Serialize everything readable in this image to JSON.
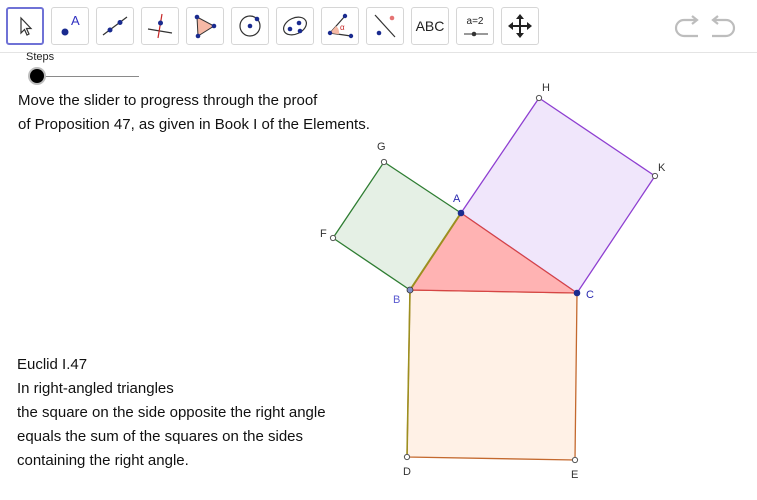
{
  "toolbar": {
    "tools": [
      {
        "name": "move-tool",
        "icon": "arrow-cursor-icon"
      },
      {
        "name": "point-tool",
        "icon": "point-icon",
        "glyph": "A"
      },
      {
        "name": "line-tool",
        "icon": "line-through-points-icon"
      },
      {
        "name": "perpendicular-tool",
        "icon": "perpendicular-line-icon"
      },
      {
        "name": "polygon-tool",
        "icon": "polygon-icon"
      },
      {
        "name": "circle-tool",
        "icon": "circle-center-point-icon"
      },
      {
        "name": "conic-tool",
        "icon": "ellipse-icon"
      },
      {
        "name": "angle-tool",
        "icon": "angle-icon"
      },
      {
        "name": "reflect-tool",
        "icon": "reflect-about-line-icon"
      },
      {
        "name": "text-tool",
        "icon": "text-icon",
        "label": "ABC"
      },
      {
        "name": "slider-tool",
        "icon": "slider-icon",
        "label": "a=2"
      },
      {
        "name": "move-view-tool",
        "icon": "move-graphics-view-icon"
      }
    ],
    "undo_icon": "undo-icon",
    "redo_icon": "redo-icon"
  },
  "slider": {
    "label": "Steps",
    "value": 0
  },
  "intro": {
    "line1": "Move the slider to progress through the proof",
    "line2": "of Proposition 47, as given in Book I of the Elements."
  },
  "statement": {
    "title": "Euclid I.47",
    "lines": [
      "In right-angled triangles",
      "the square on the side opposite the right angle",
      "equals the sum of the squares on the sides",
      "containing the right angle."
    ]
  },
  "points": {
    "A": "A",
    "B": "B",
    "C": "C",
    "D": "D",
    "E": "E",
    "F": "F",
    "G": "G",
    "H": "H",
    "K": "K"
  },
  "colors": {
    "accent": "#6f72d6",
    "triangle_fill": "#ffb3b3",
    "square_ab_fill": "#e5f0e5",
    "square_ab_stroke": "#2e7d32",
    "square_ac_fill": "#f0e6fb",
    "square_ac_stroke": "#8e3fd1",
    "square_bc_fill": "#fff1e6",
    "square_bc_stroke": "#c4692e",
    "point_dark": "#1a2b8f",
    "label_blue": "#3030c0"
  }
}
